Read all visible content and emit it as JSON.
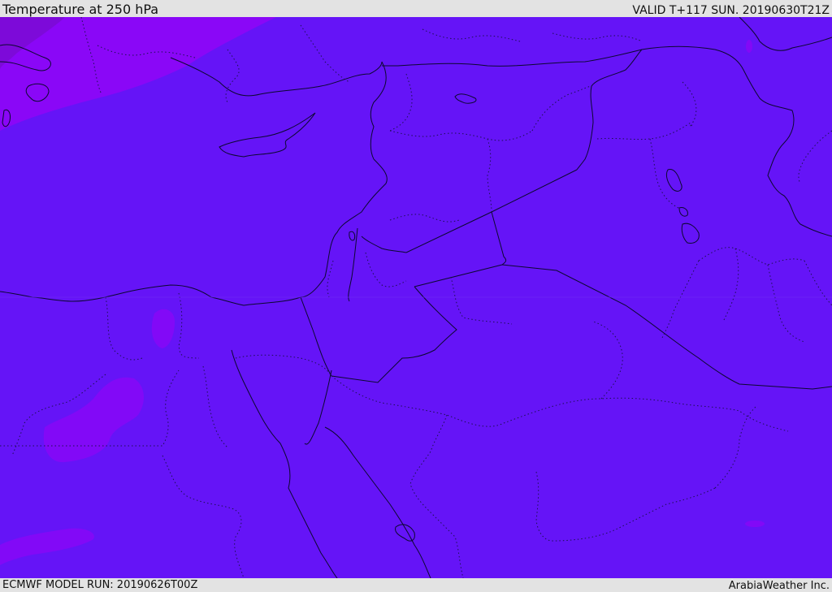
{
  "header": {
    "title": "Temperature at 250 hPa",
    "valid_time": "VALID T+117 SUN. 20190630T21Z"
  },
  "footer": {
    "model_run": "ECMWF MODEL RUN: 20190626T00Z",
    "credit": "ArabiaWeather Inc."
  },
  "map": {
    "field": "temperature",
    "level": "250 hPa",
    "colors": {
      "base_fill": "#6514f7",
      "warm_patch": "#8a07f7",
      "hot_patch": "#7d0ad9",
      "coast": "#0c0830",
      "border_dotted": "#1c1050"
    }
  }
}
